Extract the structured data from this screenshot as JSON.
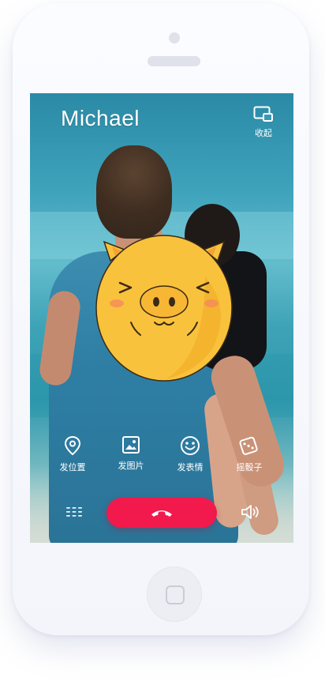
{
  "call": {
    "caller_name": "Michael",
    "collapse_label": "收起"
  },
  "actions": [
    {
      "label": "发位置",
      "icon": "location-pin-icon"
    },
    {
      "label": "发图片",
      "icon": "image-icon"
    },
    {
      "label": "发表情",
      "icon": "smiley-icon"
    },
    {
      "label": "摇骰子",
      "icon": "dice-icon"
    }
  ],
  "controls": {
    "dialpad_icon": "dialpad-icon",
    "hangup_icon": "hang-up-phone-icon",
    "speaker_icon": "speaker-icon"
  },
  "colors": {
    "hangup": "#f2194c",
    "avatar": "#f9c23c",
    "text": "#ffffff"
  }
}
